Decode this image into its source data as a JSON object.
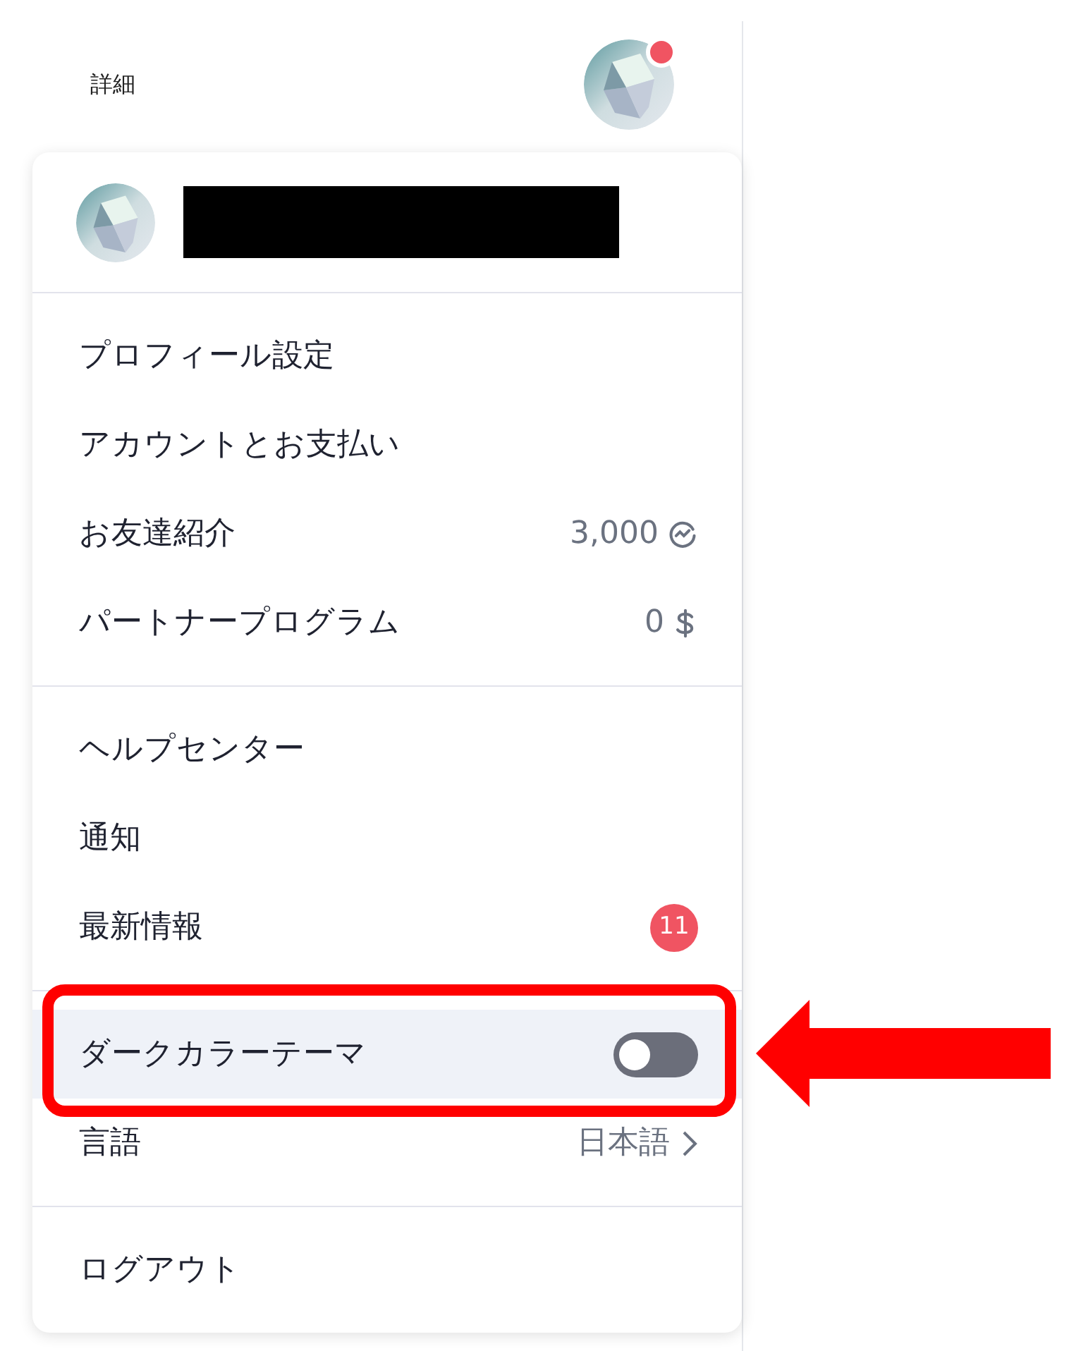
{
  "header": {
    "title": "詳細",
    "avatar": {
      "kind": "picture",
      "notification": true
    }
  },
  "menu": {
    "profile": {
      "avatar": {
        "kind": "picture"
      },
      "name_redacted": true
    },
    "sections": [
      {
        "items": [
          {
            "kind": "link",
            "label": "プロフィール設定",
            "highlighted": false
          },
          {
            "kind": "link",
            "label": "アカウントとお支払い",
            "highlighted": false
          },
          {
            "kind": "points",
            "label": "お友達紹介",
            "value": "3,000",
            "highlighted": false
          },
          {
            "kind": "dollar",
            "label": "パートナープログラム",
            "value": "0",
            "highlighted": false
          }
        ]
      },
      {
        "items": [
          {
            "kind": "link",
            "label": "ヘルプセンター",
            "highlighted": false
          },
          {
            "kind": "link",
            "label": "通知",
            "highlighted": false
          },
          {
            "kind": "badge",
            "label": "最新情報",
            "badge": "11",
            "highlighted": false
          }
        ]
      },
      {
        "items": [
          {
            "kind": "toggle",
            "label": "ダークカラーテーマ",
            "on": false,
            "highlighted": true
          },
          {
            "kind": "select",
            "label": "言語",
            "value": "日本語",
            "highlighted": false
          }
        ]
      },
      {
        "items": [
          {
            "kind": "link",
            "label": "ログアウト",
            "highlighted": false
          }
        ]
      }
    ]
  }
}
